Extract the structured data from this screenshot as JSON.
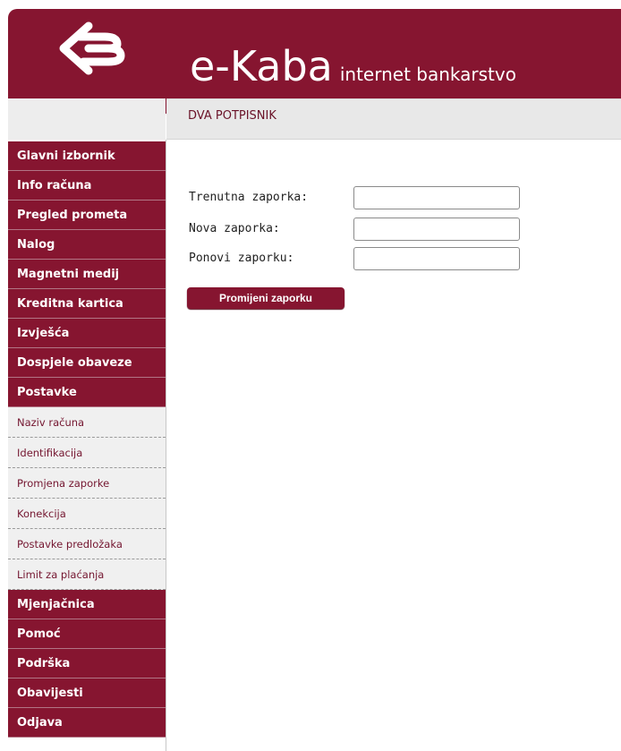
{
  "header": {
    "brand_name": "e-Kaba",
    "brand_tagline": "internet bankarstvo"
  },
  "subheader": {
    "user_name": "DVA POTPISNIK"
  },
  "sidebar": {
    "items_top": [
      {
        "label": "Glavni izbornik"
      },
      {
        "label": "Info računa"
      },
      {
        "label": "Pregled prometa"
      },
      {
        "label": "Nalog"
      },
      {
        "label": "Magnetni medij"
      },
      {
        "label": "Kreditna kartica"
      },
      {
        "label": "Izvješća"
      },
      {
        "label": "Dospjele obaveze"
      },
      {
        "label": "Postavke"
      }
    ],
    "submenu": [
      {
        "label": "Naziv računa"
      },
      {
        "label": "Identifikacija"
      },
      {
        "label": "Promjena zaporke"
      },
      {
        "label": "Konekcija"
      },
      {
        "label": "Postavke predložaka"
      },
      {
        "label": "Limit za plaćanja"
      }
    ],
    "items_bottom": [
      {
        "label": "Mjenjačnica"
      },
      {
        "label": "Pomoć"
      },
      {
        "label": "Podrška"
      },
      {
        "label": "Obavijesti"
      },
      {
        "label": "Odjava"
      }
    ]
  },
  "form": {
    "current_password_label": "Trenutna zaporka:",
    "current_password_value": "",
    "new_password_label": "Nova zaporka:",
    "new_password_value": "",
    "repeat_password_label": "Ponovi zaporku:",
    "repeat_password_value": "",
    "submit_label": "Promijeni zaporku"
  },
  "colors": {
    "brand": "#861530",
    "submenu_bg": "#f0f0f0",
    "subheader_bg": "#e8e8e8"
  }
}
